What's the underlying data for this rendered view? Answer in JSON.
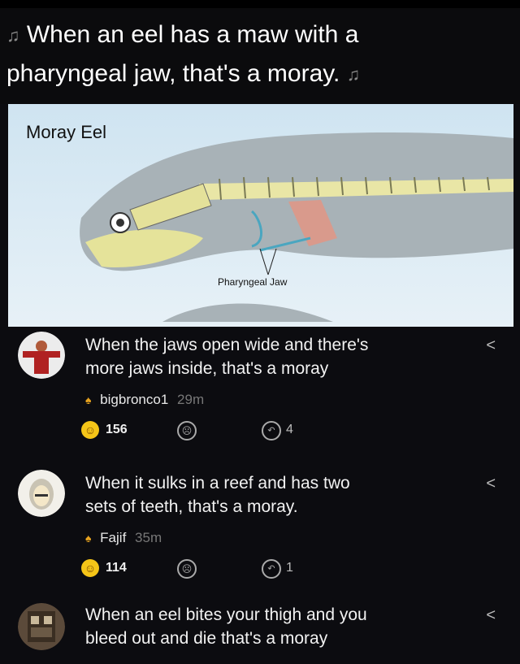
{
  "header": {
    "line1": "When an eel has a maw with a",
    "line2": "pharyngeal jaw, that's a moray.",
    "note_icon": "♫"
  },
  "image": {
    "title": "Moray Eel",
    "label": "Pharyngeal Jaw"
  },
  "comments": [
    {
      "text1": "When the jaws open wide and there's",
      "text2": "more jaws inside, that's a moray",
      "user": "bigbronco1",
      "time": "29m",
      "likes": "156",
      "replies": "4"
    },
    {
      "text1": "When it sulks in a reef and has two",
      "text2": "sets of teeth, that's a moray.",
      "user": "Fajif",
      "time": "35m",
      "likes": "114",
      "replies": "1"
    },
    {
      "text1": "When an eel bites your thigh and you",
      "text2": "bleed out and die that's a moray"
    }
  ],
  "ui": {
    "reply_caret": "<",
    "smile_icon": "☺",
    "frown_icon": "☹",
    "reply_icon": "↶",
    "fire_icon": "♠"
  }
}
